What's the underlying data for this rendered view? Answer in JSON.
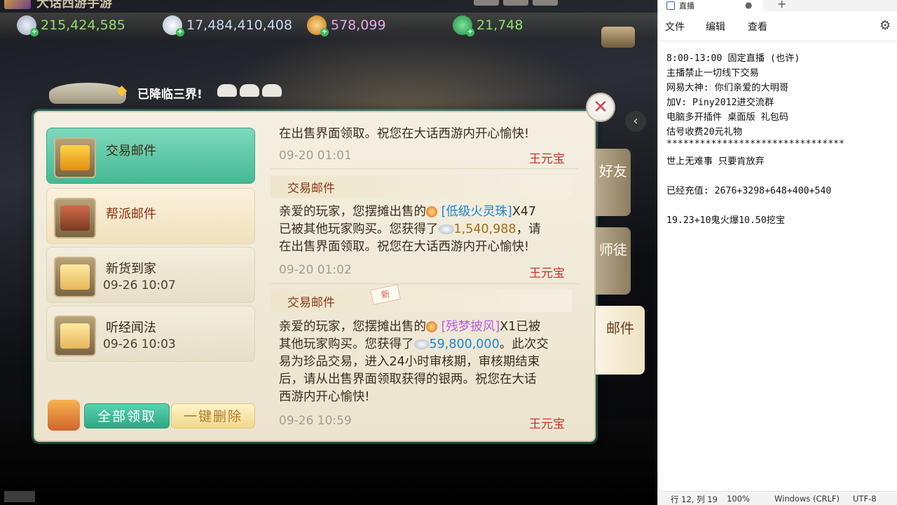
{
  "game": {
    "title": "大话西游手游",
    "currencies": [
      {
        "icon": "silver-coin-icon",
        "value": "215,424,585"
      },
      {
        "icon": "silver-ingot-icon",
        "value": "17,484,410,408"
      },
      {
        "icon": "gold-coin-icon",
        "value": "578,099"
      },
      {
        "icon": "jade-icon",
        "value": "21,748"
      }
    ],
    "announcement": "已降临三界!",
    "mail_list": [
      {
        "name": "交易邮件",
        "time": ""
      },
      {
        "name": "帮派邮件",
        "time": ""
      },
      {
        "name": "新货到家",
        "time": "09-26 10:07"
      },
      {
        "name": "听经闻法",
        "time": "09-26 10:03"
      }
    ],
    "buttons": {
      "claim_all": "全部领取",
      "delete_all": "一键删除",
      "close": "✕"
    },
    "messages": {
      "m0_text": "在出售界面领取。祝您在大话西游内开心愉快!",
      "m0_date": "09-20 01:01",
      "m0_sender": "王元宝",
      "m1_title": "交易邮件",
      "m1_l1a": "亲爱的玩家，您摆摊出售的",
      "m1_item": "[低级火灵珠]",
      "m1_l1b": "X47",
      "m1_l2a": "已被其他玩家购买。您获得了",
      "m1_amount": "1,540,988",
      "m1_l2b": "，请",
      "m1_l3": "在出售界面领取。祝您在大话西游内开心愉快!",
      "m1_date": "09-20 01:02",
      "m1_sender": "王元宝",
      "m2_title": "交易邮件",
      "m2_new": "新",
      "m2_l1a": "亲爱的玩家，您摆摊出售的",
      "m2_item": "[残梦披风]",
      "m2_l1b": "X1已被",
      "m2_l2a": "其他玩家购买。您获得了",
      "m2_amount": "59,800,000",
      "m2_l2b": "。此次交",
      "m2_l3": "易为珍品交易，进入24小时审核期，审核期结束",
      "m2_l4": "后，请从出售界面领取获得的银两。祝您在大话",
      "m2_l5": "西游内开心愉快!",
      "m2_date": "09-26 10:59",
      "m2_sender": "王元宝"
    },
    "side_tabs": [
      "好友",
      "师徒",
      "邮件"
    ],
    "colors": {
      "accent": "#45b894",
      "sender": "#c8322f",
      "item_blue": "#1a86d6",
      "item_purple": "#b75de0"
    }
  },
  "notepad": {
    "tab_title": "直播",
    "menu": [
      "文件",
      "编辑",
      "查看"
    ],
    "lines": [
      "8:00-13:00 固定直播 (也许)",
      "主播禁止一切线下交易",
      "网易大神: 你们亲爱的大明哥",
      "加V: Piny2012进交流群",
      "电脑多开插件 桌面版 礼包码",
      "估号收费20元礼物",
      "********************************",
      "世上无难事 只要肯放弃",
      "",
      "已经充值: 2676+3298+648+400+540",
      "",
      "19.23+10鬼火爆10.50挖宝"
    ],
    "status": {
      "position": "行 12, 列 19",
      "zoom": "100%",
      "eol": "Windows (CRLF)",
      "encoding": "UTF-8"
    }
  }
}
